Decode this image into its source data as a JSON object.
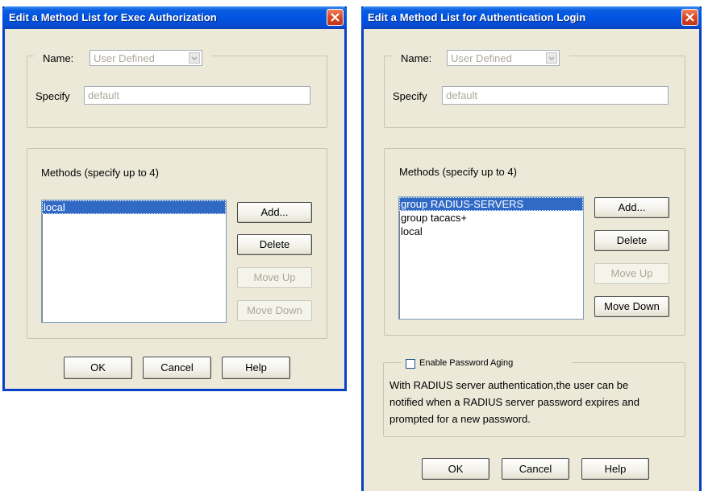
{
  "left_dialog": {
    "title": "Edit a Method List for Exec Authorization",
    "name_label": "Name:",
    "name_value": "User Defined",
    "specify_label": "Specify",
    "specify_value": "default",
    "methods_label": "Methods (specify up to 4)",
    "methods": [
      {
        "label": "local",
        "selected": true
      }
    ],
    "buttons": {
      "add": "Add...",
      "delete": "Delete",
      "move_up": "Move Up",
      "move_down": "Move Down",
      "ok": "OK",
      "cancel": "Cancel",
      "help": "Help"
    }
  },
  "right_dialog": {
    "title": "Edit a Method List for Authentication Login",
    "name_label": "Name:",
    "name_value": "User Defined",
    "specify_label": "Specify",
    "specify_value": "default",
    "methods_label": "Methods (specify up to 4)",
    "methods": [
      {
        "label": "group RADIUS-SERVERS",
        "selected": true
      },
      {
        "label": "group tacacs+",
        "selected": false
      },
      {
        "label": "local",
        "selected": false
      }
    ],
    "buttons": {
      "add": "Add...",
      "delete": "Delete",
      "move_up": "Move Up",
      "move_down": "Move Down",
      "ok": "OK",
      "cancel": "Cancel",
      "help": "Help"
    },
    "password_aging_label": "Enable Password Aging",
    "password_aging_checked": false,
    "password_aging_text_line1": "With RADIUS server authentication,the user can be",
    "password_aging_text_line2": "notified when a RADIUS server password expires and",
    "password_aging_text_line3": "prompted for a new password."
  }
}
